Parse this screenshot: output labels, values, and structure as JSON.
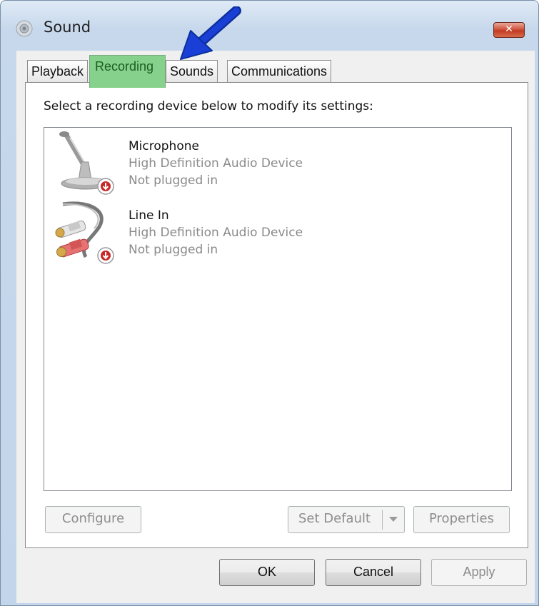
{
  "window": {
    "title": "Sound",
    "close_label": "✕"
  },
  "tabs": [
    {
      "label": "Playback",
      "active": false
    },
    {
      "label": "Recording",
      "active": true
    },
    {
      "label": "Sounds",
      "active": false
    },
    {
      "label": "Communications",
      "active": false
    }
  ],
  "panel": {
    "instructions": "Select a recording device below to modify its settings:",
    "devices": [
      {
        "name": "Microphone",
        "description": "High Definition Audio Device",
        "status": "Not plugged in",
        "icon": "microphone-icon"
      },
      {
        "name": "Line In",
        "description": "High Definition Audio Device",
        "status": "Not plugged in",
        "icon": "line-in-cable-icon"
      }
    ],
    "buttons": {
      "configure": "Configure",
      "set_default": "Set Default",
      "properties": "Properties"
    }
  },
  "footer": {
    "ok": "OK",
    "cancel": "Cancel",
    "apply": "Apply"
  },
  "colors": {
    "active_tab_highlight": "#86d18c",
    "annotation_arrow": "#1a3fd6"
  }
}
